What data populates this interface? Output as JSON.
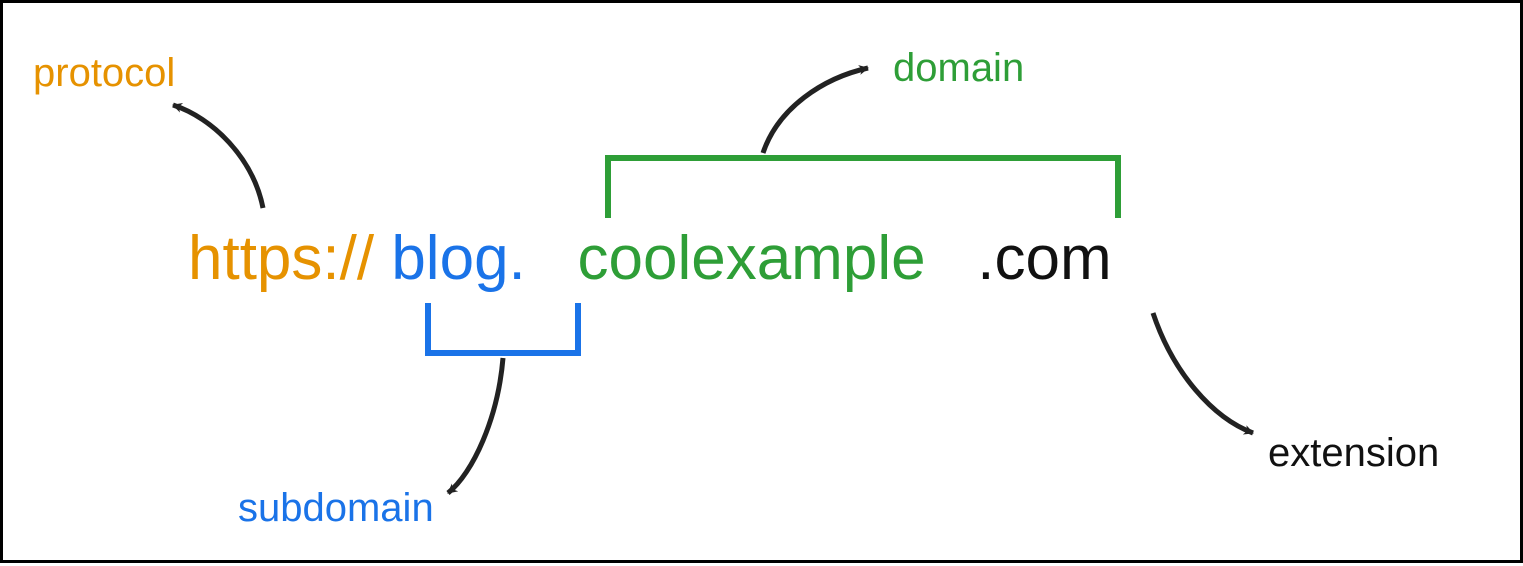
{
  "url_parts": {
    "protocol": "https://",
    "subdomain": "blog.",
    "domain_name": "coolexample",
    "extension": ".com"
  },
  "labels": {
    "protocol": "protocol",
    "subdomain": "subdomain",
    "domain": "domain",
    "extension": "extension"
  },
  "colors": {
    "protocol": "#e69200",
    "subdomain": "#1a73e8",
    "domain": "#2e9e37",
    "extension": "#111111",
    "arrow": "#222222"
  }
}
